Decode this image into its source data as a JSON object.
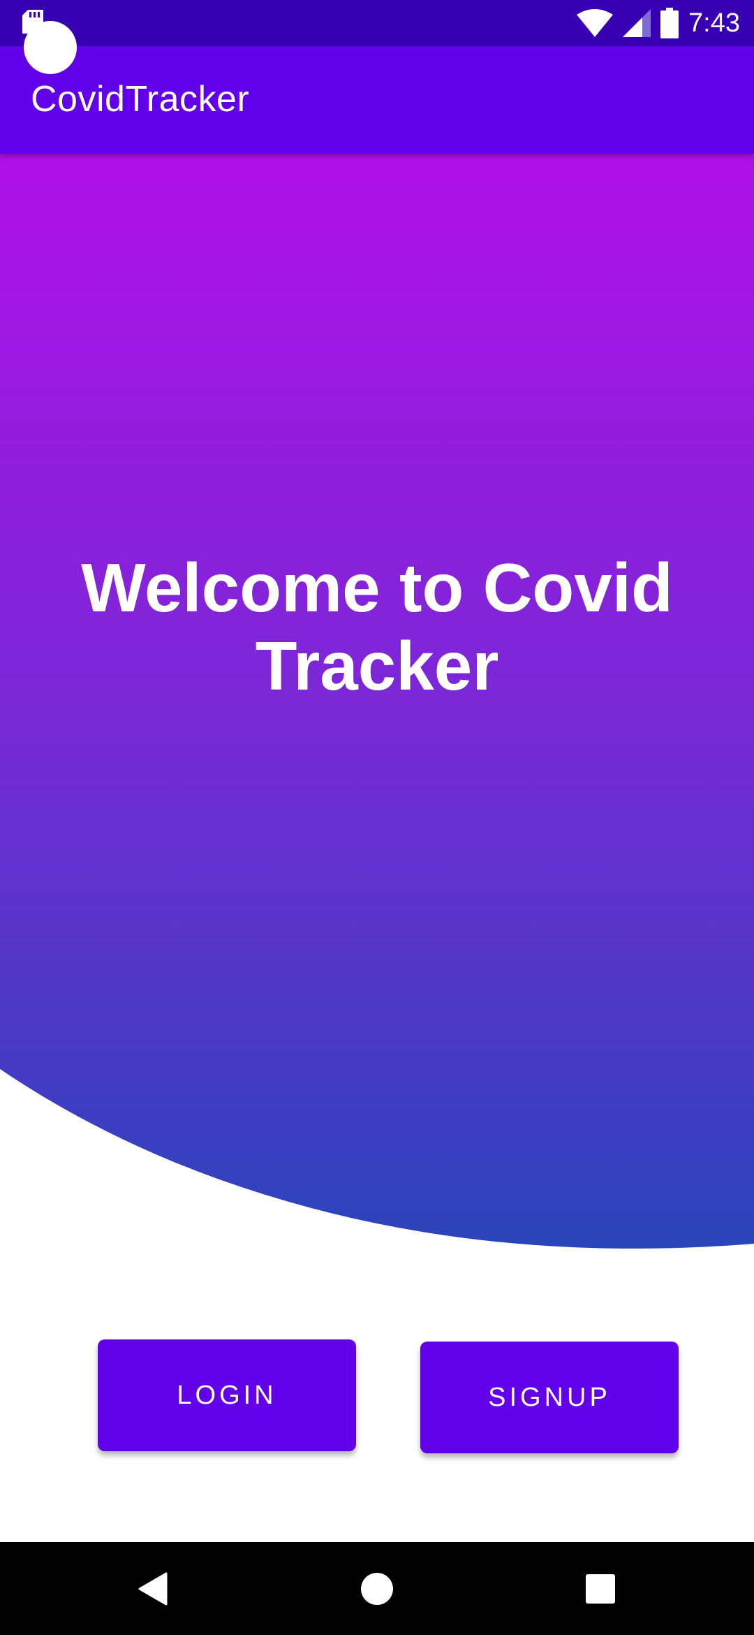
{
  "status_bar": {
    "time": "7:43",
    "icons": [
      "sd-card-icon",
      "wifi-icon",
      "cellular-signal-icon",
      "battery-icon"
    ]
  },
  "app_bar": {
    "title": "CovidTracker"
  },
  "hero": {
    "welcome_text": "Welcome to Covid Tracker",
    "gradient_top": "#b010e8",
    "gradient_bottom": "#2a44bb"
  },
  "actions": {
    "login_label": "LOGIN",
    "signup_label": "SIGNUP"
  },
  "colors": {
    "primary": "#6200ea",
    "primary_dark": "#3700b3"
  },
  "nav_bar": {
    "buttons": [
      "back-icon",
      "home-icon",
      "recents-icon"
    ]
  }
}
